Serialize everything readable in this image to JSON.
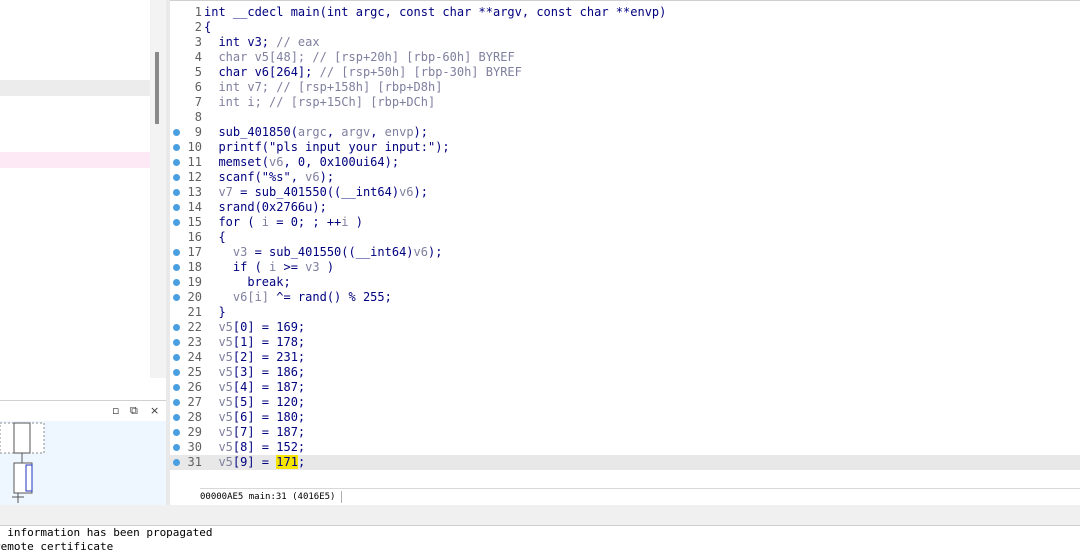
{
  "colors": {
    "keyword": "#00007f",
    "variable": "#7f7f9f",
    "highlight": "#f5e500",
    "breakpoint": "#4a9fe0"
  },
  "left_panel": {
    "close_label": "×"
  },
  "code": [
    {
      "n": "1",
      "html": "int __cdecl main(int argc, const char **argv, const char **envp)",
      "bp": false
    },
    {
      "n": "2",
      "html": "{",
      "bp": false
    },
    {
      "n": "3",
      "html": "  int v3; <span class=\"cmt\">// eax</span>",
      "bp": false
    },
    {
      "n": "4",
      "html": "  <span class=\"var\">char v5[48];</span> <span class=\"cmt\">// [rsp+20h] [rbp-60h] BYREF</span>",
      "bp": false
    },
    {
      "n": "5",
      "html": "  char v6[264]; <span class=\"cmt\">// [rsp+50h] [rbp-30h] BYREF</span>",
      "bp": false
    },
    {
      "n": "6",
      "html": "  <span class=\"var\">int v7;</span> <span class=\"cmt\">// [rsp+158h] [rbp+D8h]</span>",
      "bp": false
    },
    {
      "n": "7",
      "html": "  <span class=\"var\">int i;</span> <span class=\"cmt\">// [rsp+15Ch] [rbp+DCh]</span>",
      "bp": false
    },
    {
      "n": "8",
      "html": "",
      "bp": false
    },
    {
      "n": "9",
      "html": "  sub_401850(<span class=\"var\">argc</span>, <span class=\"var\">argv</span>, <span class=\"var\">envp</span>);",
      "bp": true
    },
    {
      "n": "10",
      "html": "  printf(\"pls input your input:\");",
      "bp": true
    },
    {
      "n": "11",
      "html": "  memset(<span class=\"var\">v6</span>, 0, 0x100ui64);",
      "bp": true
    },
    {
      "n": "12",
      "html": "  scanf(\"%s\", <span class=\"var\">v6</span>);",
      "bp": true
    },
    {
      "n": "13",
      "html": "  <span class=\"var\">v7</span> = sub_401550((__int64)<span class=\"var\">v6</span>);",
      "bp": true
    },
    {
      "n": "14",
      "html": "  srand(0x2766u);",
      "bp": true
    },
    {
      "n": "15",
      "html": "  for ( <span class=\"var\">i</span> = 0; ; ++<span class=\"var\">i</span> )",
      "bp": true
    },
    {
      "n": "16",
      "html": "  {",
      "bp": false
    },
    {
      "n": "17",
      "html": "    <span class=\"var\">v3</span> = sub_401550((__int64)<span class=\"var\">v6</span>);",
      "bp": true
    },
    {
      "n": "18",
      "html": "    if ( <span class=\"var\">i</span> &gt;= <span class=\"var\">v3</span> )",
      "bp": true
    },
    {
      "n": "19",
      "html": "      break;",
      "bp": true
    },
    {
      "n": "20",
      "html": "    <span class=\"var\">v6[i]</span> ^= rand() % 255;",
      "bp": true
    },
    {
      "n": "21",
      "html": "  }",
      "bp": false
    },
    {
      "n": "22",
      "html": "  <span class=\"var\">v5</span>[0] = 169;",
      "bp": true
    },
    {
      "n": "23",
      "html": "  <span class=\"var\">v5</span>[1] = 178;",
      "bp": true
    },
    {
      "n": "24",
      "html": "  <span class=\"var\">v5</span>[2] = 231;",
      "bp": true
    },
    {
      "n": "25",
      "html": "  <span class=\"var\">v5</span>[3] = 186;",
      "bp": true
    },
    {
      "n": "26",
      "html": "  <span class=\"var\">v5</span>[4] = 187;",
      "bp": true
    },
    {
      "n": "27",
      "html": "  <span class=\"var\">v5</span>[5] = 120;",
      "bp": true
    },
    {
      "n": "28",
      "html": "  <span class=\"var\">v5</span>[6] = 180;",
      "bp": true
    },
    {
      "n": "29",
      "html": "  <span class=\"var\">v5</span>[7] = 187;",
      "bp": true
    },
    {
      "n": "30",
      "html": "  <span class=\"var\">v5</span>[8] = 152;",
      "bp": true
    },
    {
      "n": "31",
      "html": "  <span class=\"var\">v5</span>[9] = <span class=\"hl\">171</span>;",
      "bp": true
    }
  ],
  "status_bar": "00000AE5 main:31 (4016E5)",
  "output_lines": [
    "  information has been propagated",
    "remote certificate"
  ]
}
